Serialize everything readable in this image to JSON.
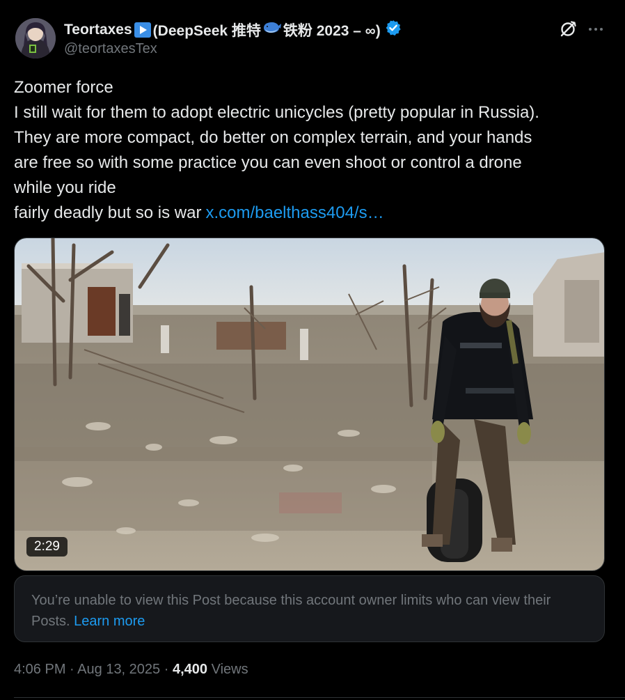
{
  "post": {
    "author_name_prefix": "Teortaxes",
    "author_name_mid": "(DeepSeek 推特",
    "author_name_suffix": "铁粉 2023 – ∞)",
    "handle": "@teortaxesTex",
    "icons": {
      "play_emoji": "play-button-emoji",
      "whale_emoji": "whale-emoji",
      "verified": "verified-badge-icon",
      "grok": "grok-icon",
      "more": "more-options-icon"
    },
    "text_lines": [
      "Zoomer force",
      "I still wait for them to adopt electric unicycles (pretty popular in Russia).",
      "They are more compact, do better on complex terrain, and your hands",
      "are free so with some practice you can even shoot or control a drone",
      "while you ride",
      "fairly deadly but so is war"
    ],
    "link_text": "x.com/baelthass404/s…",
    "video_duration": "2:29",
    "quote_notice": "You’re unable to view this Post because this account owner limits who can view their Posts.",
    "learn_more": "Learn more",
    "time": "4:06 PM",
    "date": "Aug 13, 2025",
    "separator": "·",
    "views_count": "4,400",
    "views_label": "Views"
  },
  "colors": {
    "background": "#000000",
    "text": "#e7e9ea",
    "muted": "#71767b",
    "link": "#1d9bf0",
    "verified": "#1d9bf0"
  }
}
